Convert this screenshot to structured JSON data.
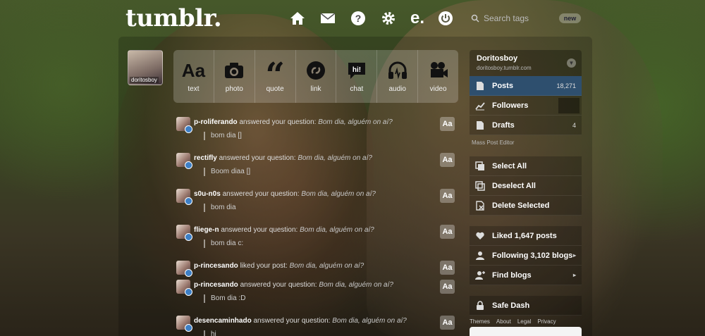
{
  "header": {
    "logo": "tumblr.",
    "nav": [
      {
        "name": "home-icon"
      },
      {
        "name": "mail-icon"
      },
      {
        "name": "help-icon"
      },
      {
        "name": "gear-icon"
      },
      {
        "name": "e-icon",
        "text": "e."
      },
      {
        "name": "power-icon"
      }
    ],
    "search_placeholder": "Search tags",
    "new_badge": "new"
  },
  "avatar_label": "doritosboy",
  "post_types": [
    {
      "icon": "text-icon",
      "glyph": "Aa",
      "label": "text"
    },
    {
      "icon": "camera-icon",
      "label": "photo"
    },
    {
      "icon": "quote-icon",
      "glyph": "“",
      "label": "quote"
    },
    {
      "icon": "link-icon",
      "label": "link"
    },
    {
      "icon": "chat-icon",
      "label": "chat"
    },
    {
      "icon": "headphones-icon",
      "label": "audio"
    },
    {
      "icon": "video-camera-icon",
      "label": "video"
    }
  ],
  "notifications": [
    {
      "user": "p-roliferando",
      "action": "answered your question:",
      "question": "Bom dia, alguém on aí?",
      "answer": "bom dia []",
      "aa": "Aa"
    },
    {
      "user": "rectifly",
      "action": "answered your question:",
      "question": "Bom dia, alguém on aí?",
      "answer": "Boom diaa []",
      "aa": "Aa"
    },
    {
      "user": "s0u-n0s",
      "action": "answered your question:",
      "question": "Bom dia, alguém on aí?",
      "answer": "bom dia",
      "aa": "Aa"
    },
    {
      "user": "fliege-n",
      "action": "answered your question:",
      "question": "Bom dia, alguém on aí?",
      "answer": "bom dia c:",
      "aa": "Aa"
    },
    {
      "user": "p-rincesando",
      "action": "liked your post:",
      "question": "Bom dia, alguém on aí?",
      "answer": "",
      "aa": "Aa"
    },
    {
      "user": "p-rincesando",
      "action": "answered your question:",
      "question": "Bom dia, alguém on aí?",
      "answer": "Bom dia :D",
      "aa": "Aa"
    },
    {
      "user": "desencaminhado",
      "action": "answered your question:",
      "question": "Bom dia, alguém on aí?",
      "answer": "hi",
      "aa": "Aa"
    }
  ],
  "sidebar": {
    "blog_name": "Doritosboy",
    "blog_url": "doritosboy.tumblr.com",
    "items": [
      {
        "label": "Posts",
        "count": "18,271",
        "icon": "document-icon"
      },
      {
        "label": "Followers",
        "count": "",
        "icon": "chart-icon"
      },
      {
        "label": "Drafts",
        "count": "4",
        "icon": "document-icon"
      }
    ],
    "mass_editor": "Mass Post Editor",
    "actions": [
      {
        "label": "Select All",
        "icon": "select-icon"
      },
      {
        "label": "Deselect All",
        "icon": "deselect-icon"
      },
      {
        "label": "Delete Selected",
        "icon": "delete-icon"
      }
    ],
    "social": [
      {
        "label": "Liked 1,647 posts",
        "icon": "heart-icon"
      },
      {
        "label": "Following 3,102 blogs",
        "icon": "person-icon"
      },
      {
        "label": "Find blogs",
        "icon": "find-person-icon"
      }
    ],
    "safe_dash": "Safe Dash",
    "footer": [
      "Themes",
      "About",
      "Legal",
      "Privacy"
    ]
  }
}
